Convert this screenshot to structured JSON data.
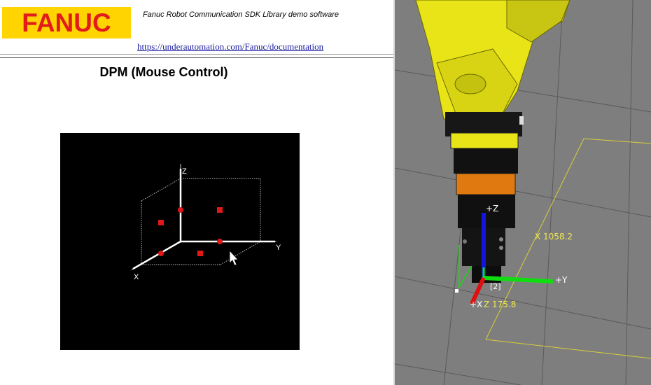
{
  "header": {
    "logo_text": "FANUC",
    "sdk_title": "Fanuc Robot Communication SDK Library demo software",
    "doc_link": "https://underautomation.com/Fanuc/documentation"
  },
  "dpm": {
    "title": "DPM (Mouse Control)",
    "axes": {
      "z": "Z",
      "y": "Y",
      "x": "X"
    }
  },
  "viewer": {
    "frame_labels": {
      "z": "+Z",
      "y": "+Y",
      "x": "+X",
      "tool_frame": "[2]"
    },
    "position_readout": {
      "x": "X 1058.2",
      "z": "Z 175.8"
    }
  },
  "colors": {
    "fanuc_yellow": "#ffd400",
    "fanuc_red": "#e21b1b",
    "link": "#1a1a9f",
    "robot_yellow": "#e8e417",
    "readout": "#f0e84c",
    "axis_x": "#e01010",
    "axis_y": "#10dd10",
    "axis_z": "#1414e0"
  }
}
